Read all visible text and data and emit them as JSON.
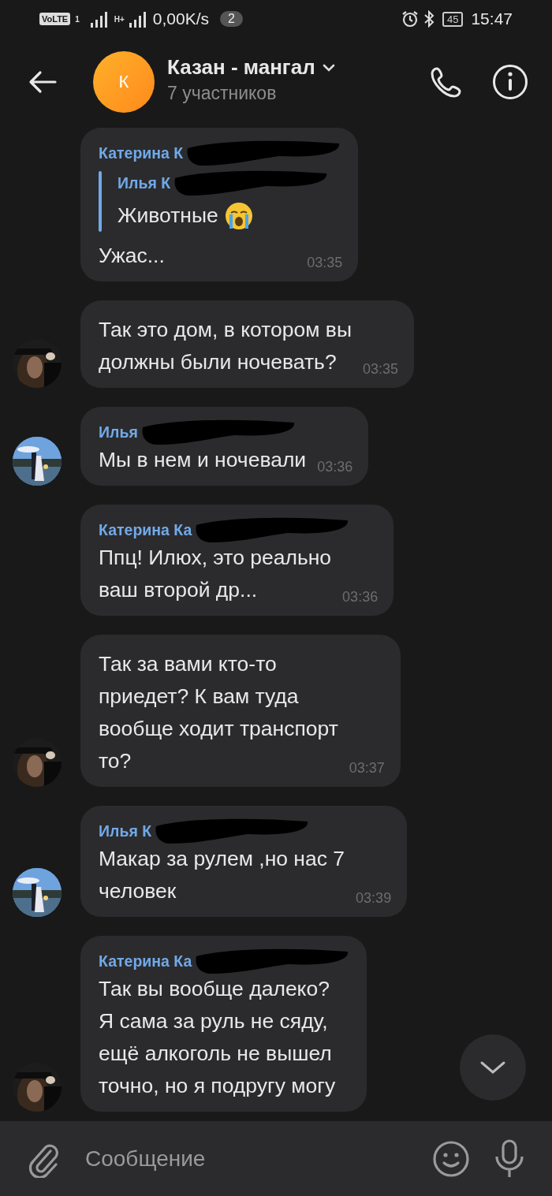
{
  "status_bar": {
    "volte": "VoLTE",
    "sim": "1",
    "network_type": "H+",
    "speed": "0,00K/s",
    "notifications": "2",
    "battery": "45",
    "time": "15:47"
  },
  "header": {
    "avatar_letter": "К",
    "title": "Казан - мангал",
    "subtitle": "7 участников"
  },
  "messages": [
    {
      "sender": "Катерина К",
      "redacted": true,
      "reply": {
        "sender": "Илья К",
        "redacted": true,
        "text": "Животные"
      },
      "text": "Ужас...",
      "time": "03:35"
    },
    {
      "text": "Так это дом, в котором вы\nдолжны были ночевать?",
      "time": "03:35"
    },
    {
      "sender": "Илья",
      "redacted": true,
      "text": "Мы в нем и ночевали",
      "time": "03:36"
    },
    {
      "sender": "Катерина Ка",
      "redacted": true,
      "text": "Ппц! Илюх, это реально\nваш второй др...",
      "time": "03:36"
    },
    {
      "text": "Так за вами кто-то\nприедет? К вам туда\nвообще ходит транспорт\nто?",
      "time": "03:37"
    },
    {
      "sender": "Илья К",
      "redacted": true,
      "text": "Макар за рулем ,но нас 7\nчеловек",
      "time": "03:39"
    },
    {
      "sender": "Катерина Ка",
      "redacted": true,
      "text": "Так вы вообще далеко?\nЯ сама за руль не сяду,\nещё алкоголь не вышел\nточно, но я подругу могу"
    }
  ],
  "composer": {
    "placeholder": "Сообщение"
  }
}
